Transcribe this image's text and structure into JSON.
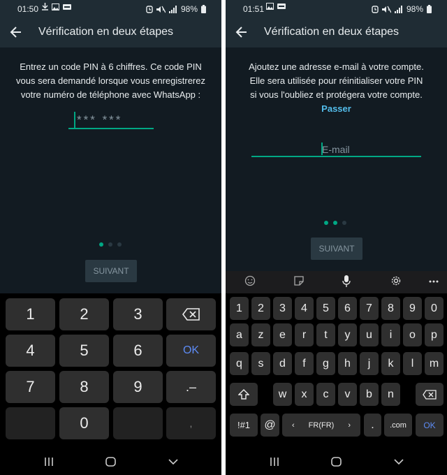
{
  "left": {
    "status": {
      "time": "01:50",
      "battery": "98%"
    },
    "title": "Vérification en deux étapes",
    "description": [
      "Entrez un code PIN à 6 chiffres. Ce code PIN",
      "vous sera demandé lorsque vous enregistrerez",
      "votre numéro de téléphone avec WhatsApp :"
    ],
    "pin_placeholder": "*** ***",
    "next_label": "SUIVANT",
    "numpad": {
      "k1": "1",
      "k2": "2",
      "k3": "3",
      "k4": "4",
      "k5": "5",
      "k6": "6",
      "k7": "7",
      "k8": "8",
      "k9": "9",
      "k0": "0",
      "ok": "OK",
      "punct": ".–",
      "comma": ","
    }
  },
  "right": {
    "status": {
      "time": "01:51",
      "battery": "98%"
    },
    "title": "Vérification en deux étapes",
    "description": [
      "Ajoutez une adresse e-mail à votre compte.",
      "Elle sera utilisée pour réinitialiser votre PIN",
      "si vous l'oubliez et protégera votre compte."
    ],
    "skip_label": "Passer",
    "email_placeholder": "E-mail",
    "next_label": "SUIVANT",
    "keyboard": {
      "row_numbers": [
        "1",
        "2",
        "3",
        "4",
        "5",
        "6",
        "7",
        "8",
        "9",
        "0"
      ],
      "row1": [
        "a",
        "z",
        "e",
        "r",
        "t",
        "y",
        "u",
        "i",
        "o",
        "p"
      ],
      "row2": [
        "q",
        "s",
        "d",
        "f",
        "g",
        "h",
        "j",
        "k",
        "l",
        "m"
      ],
      "row3": [
        "w",
        "x",
        "c",
        "v",
        "b",
        "n"
      ],
      "symbols": "!#1",
      "at": "@",
      "language": "FR(FR)",
      "period": ".",
      "dotcom": ".com",
      "ok": "OK"
    }
  },
  "colors": {
    "accent": "#00a884",
    "link": "#53bdeb",
    "ok_blue": "#5d8bf4",
    "background": "#121b22",
    "appbar": "#1f2c34"
  },
  "icons": [
    "back-arrow-icon",
    "download-icon",
    "image-icon",
    "voicemail-icon",
    "alarm-icon",
    "mute-icon",
    "signal-icon",
    "battery-icon",
    "backspace-icon",
    "emoji-icon",
    "sticker-icon",
    "mic-icon",
    "settings-icon",
    "more-icon",
    "shift-icon",
    "recents-icon",
    "home-icon",
    "back-nav-icon"
  ]
}
